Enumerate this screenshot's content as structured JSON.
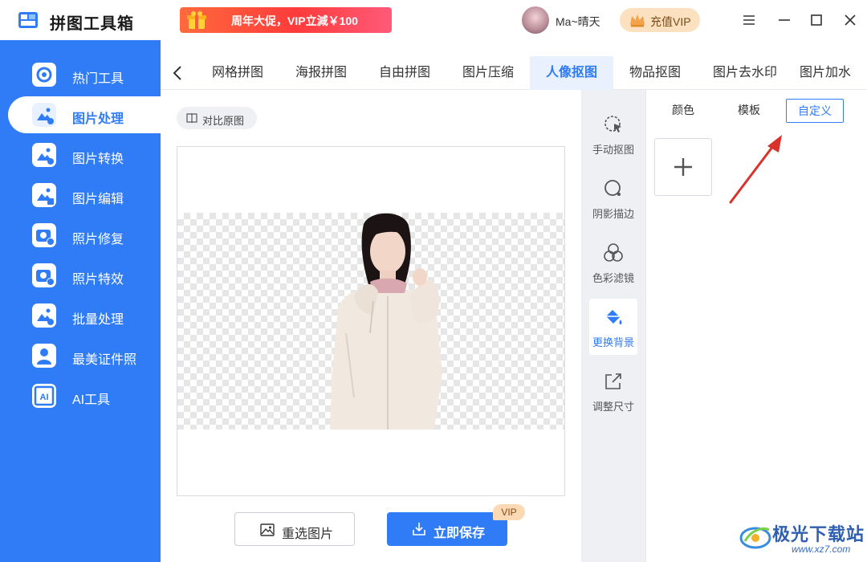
{
  "app": {
    "title": "拼图工具箱"
  },
  "promo": {
    "text": "周年大促，VIP立減￥100"
  },
  "user": {
    "name": "Ma~晴天",
    "vip_button": "充值VIP"
  },
  "window_controls": [
    "menu-icon",
    "minimize-icon",
    "maximize-icon",
    "close-icon"
  ],
  "sidebar": {
    "items": [
      {
        "label": "热门工具",
        "icon": "tools-icon"
      },
      {
        "label": "图片处理",
        "icon": "image-process-icon",
        "active": true
      },
      {
        "label": "图片转换",
        "icon": "image-convert-icon"
      },
      {
        "label": "图片编辑",
        "icon": "image-edit-icon"
      },
      {
        "label": "照片修复",
        "icon": "photo-repair-icon"
      },
      {
        "label": "照片特效",
        "icon": "photo-effect-icon"
      },
      {
        "label": "批量处理",
        "icon": "batch-icon"
      },
      {
        "label": "最美证件照",
        "icon": "id-photo-icon"
      },
      {
        "label": "AI工具",
        "icon": "ai-icon"
      }
    ]
  },
  "tabs": [
    "网格拼图",
    "海报拼图",
    "自由拼图",
    "图片压缩",
    "人像抠图",
    "物品抠图",
    "图片去水印",
    "图片加水"
  ],
  "active_tab": "人像抠图",
  "canvas": {
    "compare_label": "对比原图"
  },
  "actions": {
    "reselect": "重选图片",
    "save": "立即保存",
    "vip_tag": "VIP"
  },
  "tools": [
    {
      "label": "手动抠图",
      "icon": "cursor-select-icon"
    },
    {
      "label": "阴影描边",
      "icon": "shadow-outline-icon"
    },
    {
      "label": "色彩滤镜",
      "icon": "color-filter-icon"
    },
    {
      "label": "更换背景",
      "icon": "paint-bucket-icon",
      "active": true
    },
    {
      "label": "调整尺寸",
      "icon": "resize-icon"
    }
  ],
  "bg_panel": {
    "tabs": [
      "颜色",
      "模板",
      "自定义"
    ],
    "active": "自定义"
  },
  "watermark": {
    "name": "极光下载站",
    "url": "www.xz7.com"
  },
  "colors": {
    "accent": "#2f7cf6",
    "sidebar": "#2f7cf6",
    "promo": "#ff4a3a",
    "vip": "#fbe1c0"
  }
}
